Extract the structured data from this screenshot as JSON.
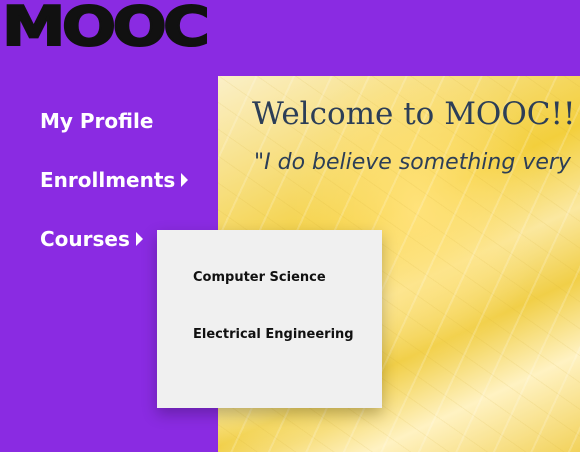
{
  "logo": {
    "text": "MOOC"
  },
  "nav": {
    "items": [
      {
        "label": "My Profile",
        "has_submenu": false
      },
      {
        "label": "Enrollments",
        "has_submenu": true
      },
      {
        "label": "Courses",
        "has_submenu": true
      }
    ]
  },
  "courses_menu": {
    "items": [
      "Computer Science",
      "Electrical Engineering"
    ]
  },
  "banner": {
    "welcome": "Welcome to MOOC!!",
    "quote": "\"I do believe something very"
  },
  "colors": {
    "page_bg": "#8a2be2",
    "nav_text": "#ffffff",
    "banner_text": "#2c3e57",
    "dropdown_bg": "#f0f0f0"
  }
}
